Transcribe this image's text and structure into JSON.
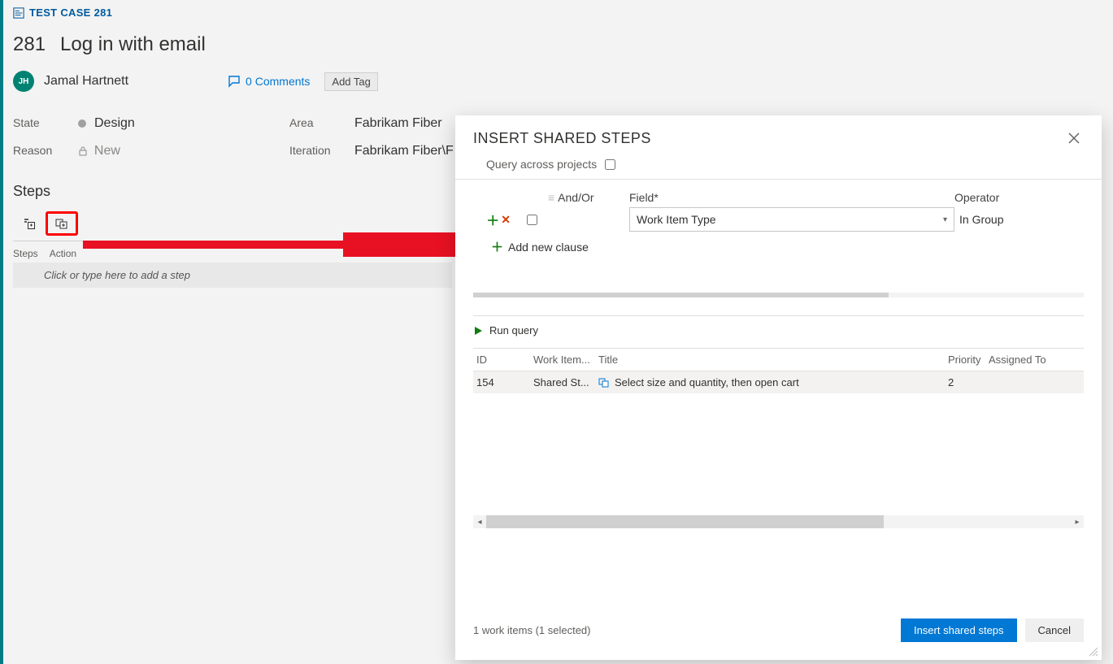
{
  "test_case": {
    "header_label": "TEST CASE 281",
    "id": "281",
    "title": "Log in with email",
    "owner_initials": "JH",
    "owner_name": "Jamal Hartnett",
    "comments_label": "0 Comments",
    "add_tag_label": "Add Tag",
    "state_label": "State",
    "state_value": "Design",
    "area_label": "Area",
    "area_value": "Fabrikam Fiber",
    "reason_label": "Reason",
    "reason_value": "New",
    "iteration_label": "Iteration",
    "iteration_value": "Fabrikam Fiber\\F"
  },
  "steps": {
    "title": "Steps",
    "col_steps": "Steps",
    "col_action": "Action",
    "placeholder": "Click or type here to add a step"
  },
  "dialog": {
    "title": "INSERT SHARED STEPS",
    "query_across_label": "Query across projects",
    "col_andor": "And/Or",
    "col_field": "Field*",
    "col_operator": "Operator",
    "field_value": "Work Item Type",
    "operator_value": "In Group",
    "add_clause_label": "Add new clause",
    "run_query_label": "Run query",
    "results": {
      "col_id": "ID",
      "col_wit": "Work Item...",
      "col_title": "Title",
      "col_priority": "Priority",
      "col_assigned": "Assigned To",
      "rows": [
        {
          "id": "154",
          "wit": "Shared St...",
          "title": "Select size and quantity, then open cart",
          "priority": "2",
          "assigned": ""
        }
      ]
    },
    "selection_info": "1 work items (1 selected)",
    "insert_label": "Insert shared steps",
    "cancel_label": "Cancel"
  }
}
